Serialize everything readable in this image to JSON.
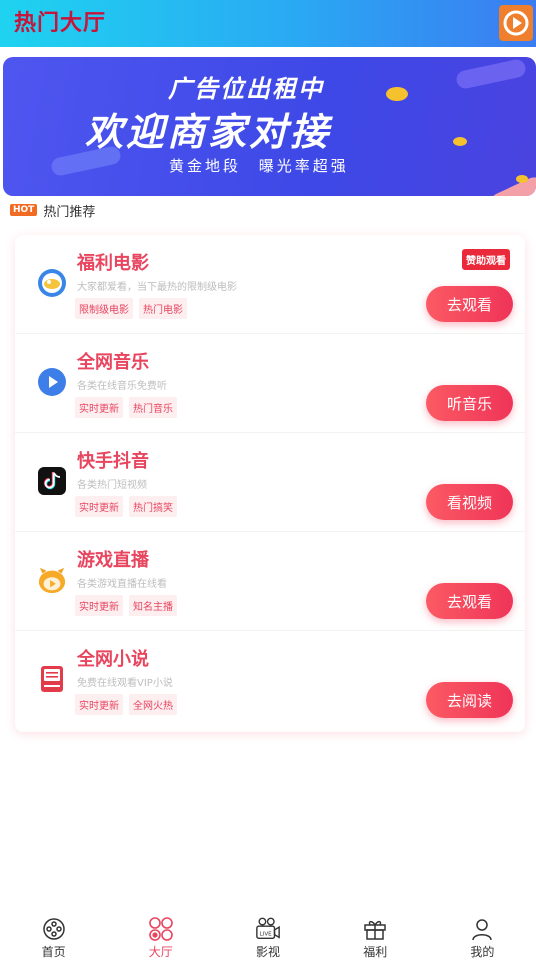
{
  "header": {
    "title": "热门大厅",
    "accent": "#c8133a"
  },
  "banner": {
    "line1": "广告位出租中",
    "line2": "欢迎商家对接",
    "line3": "黄金地段   曝光率超强"
  },
  "section": {
    "badge": "HOT",
    "title": "热门推荐"
  },
  "rows": [
    {
      "icon": "bowl-icon",
      "title": "福利电影",
      "desc": "大家都爱看，当下最热的限制级电影",
      "tags": [
        "限制级电影",
        "热门电影"
      ],
      "button": "去观看",
      "badge": "赞助观看"
    },
    {
      "icon": "play-circle-icon",
      "title": "全网音乐",
      "desc": "各类在线音乐免费听",
      "tags": [
        "实时更新",
        "热门音乐"
      ],
      "button": "听音乐"
    },
    {
      "icon": "tiktok-icon",
      "title": "快手抖音",
      "desc": "各类热门短视频",
      "tags": [
        "实时更新",
        "热门搞笑"
      ],
      "button": "看视频"
    },
    {
      "icon": "game-mascot-icon",
      "title": "游戏直播",
      "desc": "各类游戏直播在线看",
      "tags": [
        "实时更新",
        "知名主播"
      ],
      "button": "去观看"
    },
    {
      "icon": "book-icon",
      "title": "全网小说",
      "desc": "免费在线观看VIP小说",
      "tags": [
        "实时更新",
        "全网火热"
      ],
      "button": "去阅读"
    }
  ],
  "tabbar": [
    {
      "label": "首页",
      "icon": "film-reel-icon",
      "active": false
    },
    {
      "label": "大厅",
      "icon": "grid-icon",
      "active": true
    },
    {
      "label": "影视",
      "icon": "video-camera-icon",
      "active": false
    },
    {
      "label": "福利",
      "icon": "gift-icon",
      "active": false
    },
    {
      "label": "我的",
      "icon": "user-icon",
      "active": false
    }
  ]
}
